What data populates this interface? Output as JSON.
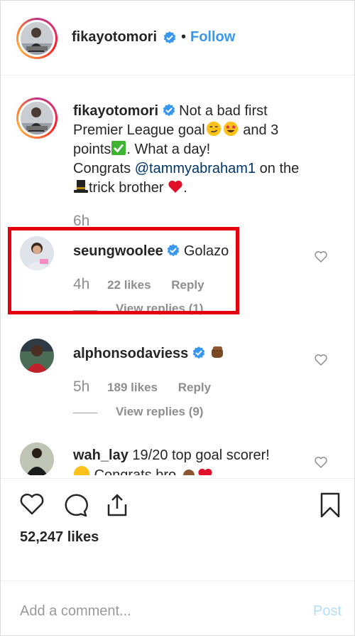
{
  "header": {
    "username": "fikayotomori",
    "separator": "•",
    "follow_label": "Follow"
  },
  "caption": {
    "username": "fikayotomori",
    "line1": "Not a bad first",
    "line2a": "Premier League goal",
    "line2b": " and 3",
    "line3": "points",
    "line3b": ". What a day!",
    "line4a": "Congrats ",
    "mention": "@tammyabraham1",
    "line4b": " on the",
    "line5": "trick brother ",
    "line5b": ".",
    "time": "6h"
  },
  "comments": [
    {
      "username": "seungwoolee",
      "text": "Golazo",
      "time": "4h",
      "likes": "22 likes",
      "reply": "Reply",
      "view_replies": "View replies (1)"
    },
    {
      "username": "alphonsodaviess",
      "text": "",
      "time": "5h",
      "likes": "189 likes",
      "reply": "Reply",
      "view_replies": "View replies (9)"
    },
    {
      "username": "wah_lay",
      "text": "19/20 top goal scorer!",
      "text2": "Congrats bro"
    }
  ],
  "footer": {
    "likes": "52,247 likes",
    "add_comment_placeholder": "Add a comment...",
    "post_label": "Post"
  },
  "colors": {
    "link_blue": "#3897f0",
    "highlight_red": "#e3000f",
    "muted": "#8e8e8e"
  }
}
